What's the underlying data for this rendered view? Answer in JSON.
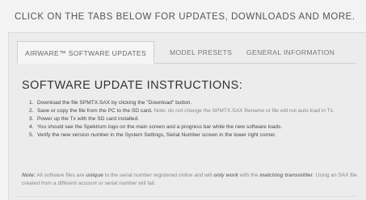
{
  "headline": "CLICK ON THE TABS BELOW FOR UPDATES, DOWNLOADS AND MORE.",
  "tabs": [
    {
      "label": "AIRWARE™ SOFTWARE UPDATES"
    },
    {
      "label": "MODEL PRESETS"
    },
    {
      "label": "GENERAL INFORMATION"
    }
  ],
  "section_title": "SOFTWARE UPDATE INSTRUCTIONS:",
  "steps": [
    {
      "num": "1.",
      "text": "Download the file SPMTX.SAX by clicking the \"Download\" button."
    },
    {
      "num": "2.",
      "text": "Save or copy the file from the PC to the SD card.",
      "note": " Note: do not change the SPMTX.SAX filename or file will not auto load in Tx."
    },
    {
      "num": "3.",
      "text": "Power up the Tx with the SD card installed."
    },
    {
      "num": "4.",
      "text": "You should see the Spektrum logo on the main screen and a progress bar while the new software loads."
    },
    {
      "num": "5.",
      "text": "Verify the new version number in the System Settings, Serial Number screen in the lower right corner."
    }
  ],
  "note": {
    "label": "Note:",
    "part1": " All software files are ",
    "em1": "unique",
    "part2": " to the serial number registered online and will ",
    "em2": "only work",
    "part3": " with the ",
    "em3": "matching transmitter",
    "part4": ". Using an SAX file created from a different account or serial number will fail."
  }
}
